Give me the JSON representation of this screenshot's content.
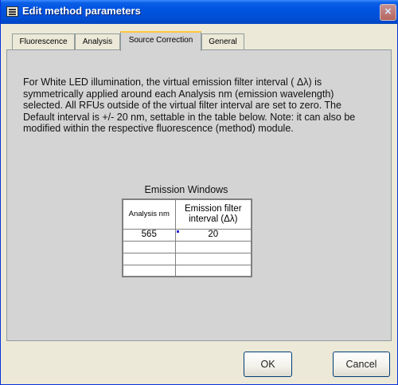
{
  "window": {
    "title": "Edit method parameters"
  },
  "tabs": [
    {
      "label": "Fluorescence"
    },
    {
      "label": "Analysis"
    },
    {
      "label": "Source Correction"
    },
    {
      "label": "General"
    }
  ],
  "active_tab": "Source Correction",
  "info_text": "For White LED illumination, the virtual emission filter interval ( Δλ) is symmetrically applied around each Analysis nm (emission wavelength) selected.  All RFUs outside of the virtual filter interval are set to zero.  The Default interval is +/- 20 nm, settable in the table below.  Note: it can also be modified within the respective fluorescence (method) module.",
  "emission_windows": {
    "title": "Emission Windows",
    "headers": [
      "Analysis nm",
      "Emission filter interval (Δλ)"
    ],
    "rows": [
      [
        "565",
        "20"
      ],
      [
        "",
        ""
      ],
      [
        "",
        ""
      ],
      [
        "",
        ""
      ]
    ]
  },
  "buttons": {
    "ok": "OK",
    "cancel": "Cancel"
  }
}
